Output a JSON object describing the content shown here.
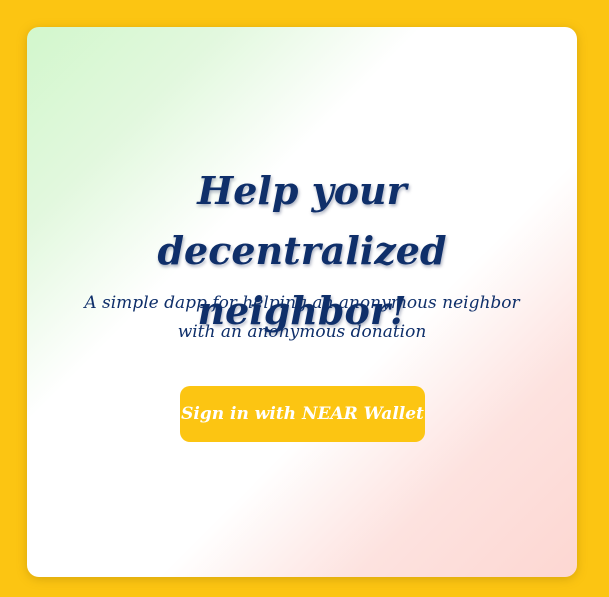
{
  "colors": {
    "background": "#fcc512",
    "accent": "#fcc512",
    "heading": "#0f2f6a",
    "button_text": "#ffffff"
  },
  "card": {
    "title": "Help your decentralized neighbor!",
    "subtitle": "A simple dapp for helping an anonymous neighbor with an anonymous donation",
    "signin_label": "Sign in with NEAR Wallet"
  }
}
